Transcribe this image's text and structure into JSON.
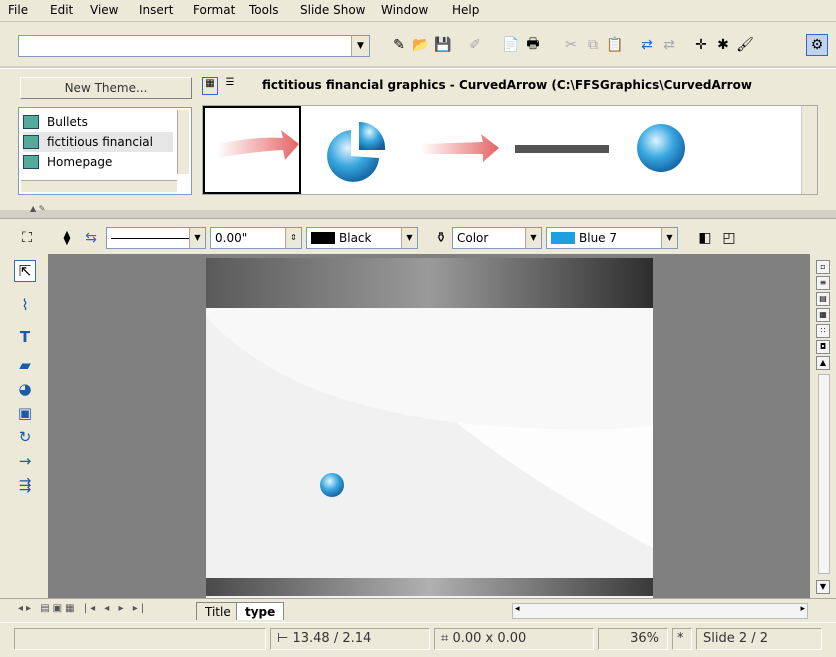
{
  "menu": [
    "File",
    "Edit",
    "View",
    "Insert",
    "Format",
    "Tools",
    "Slide Show",
    "Window",
    "Help"
  ],
  "toolbar": {
    "combo_value": ""
  },
  "gallery": {
    "new_theme_label": "New Theme...",
    "title": "fictitious financial graphics - CurvedArrow (C:\\FFSGraphics\\CurvedArrow",
    "themes": [
      "Bullets",
      "fictitious financial",
      "Homepage"
    ],
    "selected_theme": "fictitious financial"
  },
  "drawbar": {
    "line_width": "0.00\"",
    "line_color": "Black",
    "fill_type": "Color",
    "fill_color": "Blue 7",
    "line_color_hex": "#000000",
    "fill_color_hex": "#1ea0e0"
  },
  "tabs": {
    "items": [
      "Title",
      "type"
    ],
    "active": "type"
  },
  "status": {
    "position": "13.48 / 2.14",
    "size": "0.00 x 0.00",
    "zoom": "36%",
    "slide": "Slide 2 / 2"
  }
}
